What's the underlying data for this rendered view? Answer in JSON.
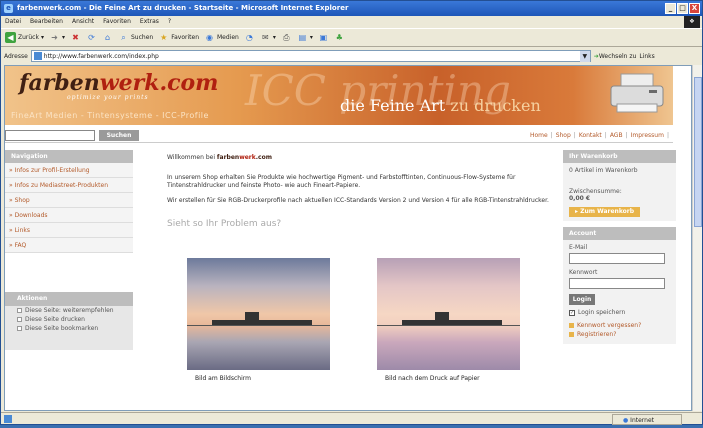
{
  "window": {
    "title": "farbenwerk.com - Die Feine Art zu drucken - Startseite - Microsoft Internet Explorer",
    "buttons": [
      "_",
      "□",
      "X"
    ]
  },
  "menubar": {
    "items": [
      "Datei",
      "Bearbeiten",
      "Ansicht",
      "Favoriten",
      "Extras",
      "?"
    ]
  },
  "toolbar": {
    "back": "Zurück",
    "search": "Suchen",
    "favorites": "Favoriten",
    "media": "Medien"
  },
  "addressbar": {
    "label": "Adresse",
    "url": "http://www.farbenwerk.com/index.php",
    "go": "Wechseln zu",
    "links": "Links"
  },
  "banner": {
    "logo_prefix": "farben",
    "logo_suffix": "werk.com",
    "tagline": "optimize your prints",
    "subtitle": "FineArt Medien - Tintensysteme - ICC-Profile",
    "watermark": "ICC printing",
    "slogan_main": "die Feine Art",
    "slogan_tail": "zu drucken"
  },
  "search": {
    "button": "Suchen",
    "value": ""
  },
  "topnav": [
    "Home",
    "Shop",
    "Kontakt",
    "AGB",
    "Impressum"
  ],
  "navigation": {
    "title": "Navigation",
    "items": [
      "» Infos zur Profil-Erstellung",
      "» Infos zu Mediastreet-Produkten",
      "» Shop",
      "» Downloads",
      "» Links",
      "» FAQ"
    ]
  },
  "actions": {
    "title": "Aktionen",
    "items": [
      "Diese Seite: weiterempfehlen",
      "Diese Seite drucken",
      "Diese Seite bookmarken"
    ]
  },
  "main": {
    "welcome_prefix": "Willkommen bei",
    "welcome_brand_a": "farben",
    "welcome_brand_b": "werk",
    "welcome_brand_c": ".com",
    "para1": "In unserem Shop erhalten Sie Produkte wie hochwertige Pigment- und Farbstofftinten, Continuous-Flow-Systeme für Tintenstrahldrucker und feinste Photo- wie auch Fineart-Papiere.",
    "para2": "Wir erstellen für Sie RGB-Druckerprofile nach aktuellen ICC-Standards Version 2 und Version 4 für alle RGB-Tintenstrahldrucker.",
    "problem": "Sieht so Ihr Problem aus?",
    "caption_left": "Bild am Bildschirm",
    "caption_right": "Bild nach dem Druck auf Papier"
  },
  "cart": {
    "title": "Ihr Warenkorb",
    "items": "0 Artikel im Warenkorb",
    "subtotal_label": "Zwischensumme:",
    "subtotal_value": "0,00 €",
    "button": "Zum Warenkorb"
  },
  "account": {
    "title": "Account",
    "email_label": "E-Mail",
    "password_label": "Kennwort",
    "login": "Login",
    "remember": "Login speichern",
    "forgot": "Kennwort vergessen?",
    "register": "Registrieren?"
  },
  "status": {
    "left": "",
    "zone": "Internet"
  },
  "colors": {
    "accent": "#b35a2a",
    "brand_red": "#b02010",
    "title_blue": "#1d56b8"
  }
}
